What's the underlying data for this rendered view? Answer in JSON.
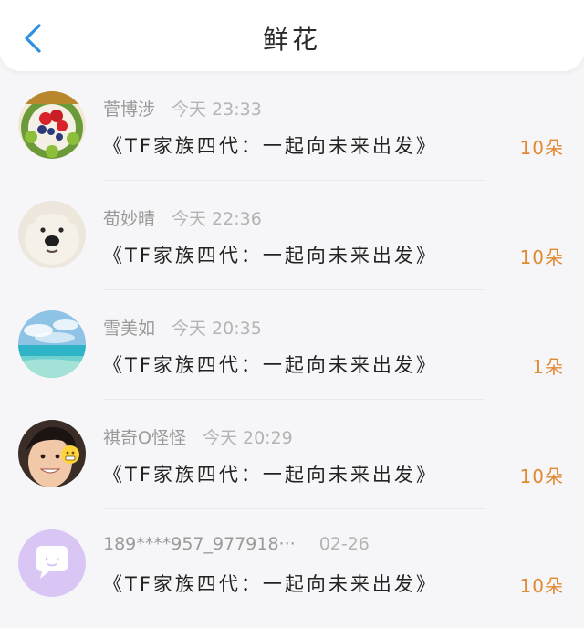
{
  "header": {
    "title": "鲜花",
    "back_icon": "chevron-left-icon",
    "back_color": "#2f8fe0"
  },
  "items": [
    {
      "name": "菅博涉",
      "time": "今天 23:33",
      "message": "《TF家族四代：一起向未来出发》",
      "amount": "10朵",
      "avatar": "fruit-tart-avatar"
    },
    {
      "name": "荀妙晴",
      "time": "今天 22:36",
      "message": "《TF家族四代：一起向未来出发》",
      "amount": "10朵",
      "avatar": "polar-bear-avatar"
    },
    {
      "name": "雪美如",
      "time": "今天 20:35",
      "message": "《TF家族四代：一起向未来出发》",
      "amount": "1朵",
      "avatar": "sea-sky-avatar"
    },
    {
      "name": "祺奇O怪怪",
      "time": "今天 20:29",
      "message": "《TF家族四代：一起向未来出发》",
      "amount": "10朵",
      "avatar": "smiling-person-avatar"
    },
    {
      "name": "189****957_977918···",
      "time": "02-26",
      "message": "《TF家族四代：一起向未来出发》",
      "amount": "10朵",
      "avatar": "default-chat-avatar"
    }
  ],
  "colors": {
    "amount": "#e08a34",
    "name": "#9a9a9a",
    "avatar_default_bg": "#d9c6f5"
  }
}
